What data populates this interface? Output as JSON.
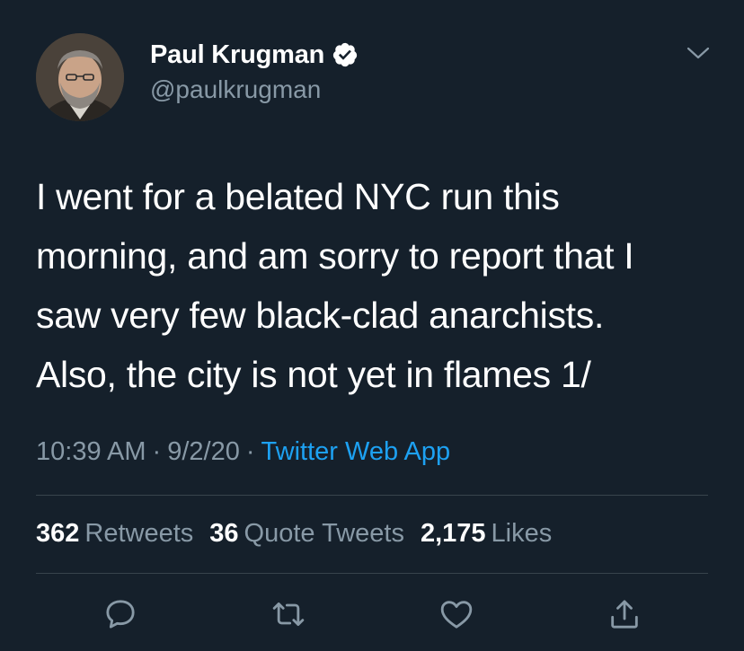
{
  "author": {
    "name": "Paul Krugman",
    "handle": "@paulkrugman",
    "verified": true
  },
  "tweet": {
    "text": "I went for a belated NYC run this\nmorning, and am sorry to report that I\nsaw very few black-clad anarchists.\nAlso, the city is not yet in flames 1/"
  },
  "meta": {
    "time": "10:39 AM",
    "separator": "·",
    "date": "9/2/20",
    "source": "Twitter Web App"
  },
  "stats": {
    "retweets_count": "362",
    "retweets_label": "Retweets",
    "quotes_count": "36",
    "quotes_label": "Quote Tweets",
    "likes_count": "2,175",
    "likes_label": "Likes"
  },
  "colors": {
    "background": "#15202b",
    "text": "#ffffff",
    "secondary": "#8899a6",
    "link": "#1da1f2",
    "divider": "#38444d"
  },
  "icons": {
    "reply": "speech-bubble-icon",
    "retweet": "retweet-icon",
    "like": "heart-icon",
    "share": "share-icon",
    "more": "chevron-down-icon",
    "verified": "verified-badge-icon"
  }
}
